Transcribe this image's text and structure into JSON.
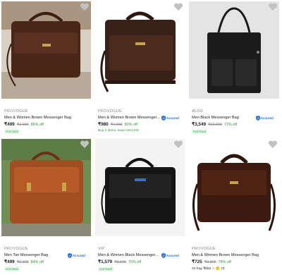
{
  "colors": {
    "accent": "#2874f0",
    "green": "#388e3c",
    "muted": "#878787"
  },
  "products": [
    {
      "brand": "PROVOGUE",
      "title": "Men & Women Brown Messenger Bag",
      "price": "₹499",
      "mrp": "₹2,999",
      "off": "86% off",
      "assured": false,
      "badge": "Hot Deal",
      "extra": ""
    },
    {
      "brand": "PROVOGUE",
      "title": "Men & Women Brown Messenger...",
      "price": "₹980",
      "mrp": "₹4,999",
      "off": "80% off",
      "assured": true,
      "badge": "",
      "extra": "Buy 2 items, save extra 5%"
    },
    {
      "brand": "ALDO",
      "title": "Men Black Messenger Bag",
      "price": "₹3,549",
      "mrp": "₹12,999",
      "off": "72% off",
      "assured": true,
      "badge": "Hot Deal",
      "extra": ""
    },
    {
      "brand": "PROVOGUE",
      "title": "Men Tan Messenger Bag",
      "price": "₹499",
      "mrp": "₹3,399",
      "off": "84% off",
      "assured": true,
      "badge": "Hot Deal",
      "extra": ""
    },
    {
      "brand": "VIP",
      "title": "Men & Women Black Messenger...",
      "price": "₹1,579",
      "mrp": "₹3,599",
      "off": "75% off",
      "assured": true,
      "badge": "Hot Deal",
      "extra": ""
    },
    {
      "brand": "PROVOGUE",
      "title": "Men & Women Brown Messenger Bag",
      "price": "₹725",
      "mrp": "₹3,999",
      "off": "78% off",
      "assured": false,
      "badge": "",
      "extra": "Or Pay ₹652 + ",
      "coins": "73"
    }
  ],
  "assured_label": "Assured",
  "icons": {
    "wishlist": "heart-icon",
    "assured": "shield-icon"
  }
}
